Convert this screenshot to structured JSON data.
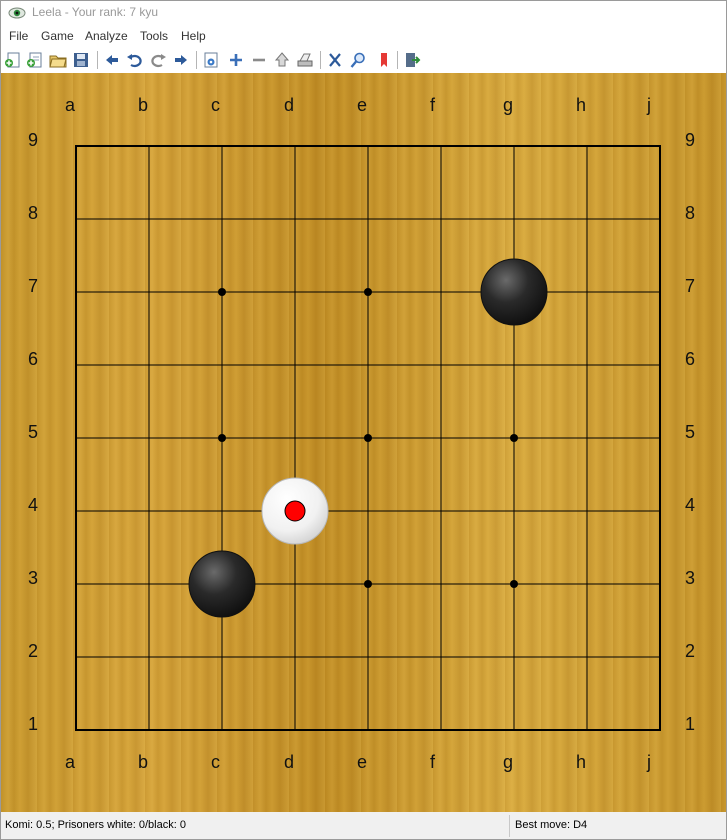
{
  "window": {
    "title": "Leela - Your rank: 7 kyu",
    "icon": "leela-eye-icon"
  },
  "menu": [
    "File",
    "Game",
    "Analyze",
    "Tools",
    "Help"
  ],
  "toolbar": {
    "buttons": [
      "new-game-icon",
      "new-custom-game-icon",
      "open-icon",
      "save-icon",
      "back-icon",
      "undo-icon",
      "redo-icon",
      "forward-icon",
      "analysis-settings-icon",
      "zoom-in-icon",
      "zoom-out-icon",
      "move-up-icon",
      "print-icon",
      "resign-icon",
      "hint-icon",
      "bookmark-icon",
      "exit-icon"
    ]
  },
  "board": {
    "size": 9,
    "columns": [
      "a",
      "b",
      "c",
      "d",
      "e",
      "f",
      "g",
      "h",
      "j"
    ],
    "rows": [
      "9",
      "8",
      "7",
      "6",
      "5",
      "4",
      "3",
      "2",
      "1"
    ],
    "star_points": [
      "c7",
      "e7",
      "c5",
      "e5",
      "g5",
      "e3",
      "g3"
    ],
    "stones": [
      {
        "color": "black",
        "point": "g7"
      },
      {
        "color": "white",
        "point": "d4",
        "last_move": true
      },
      {
        "color": "black",
        "point": "c3"
      }
    ],
    "colors": {
      "wood": "#cf9f34",
      "last_move_marker": "#ff0000"
    }
  },
  "status": {
    "left": "Komi: 0.5; Prisoners white: 0/black: 0",
    "right": "Best move: D4"
  }
}
